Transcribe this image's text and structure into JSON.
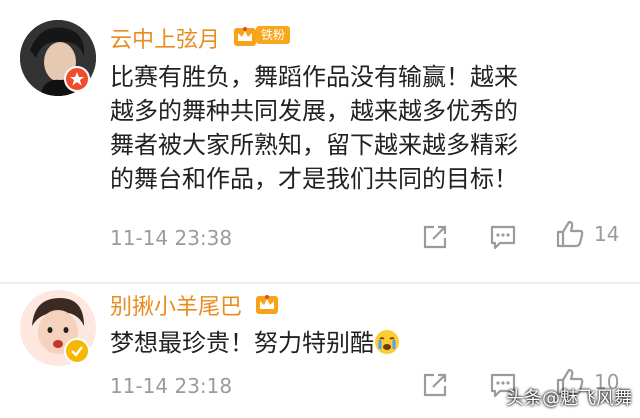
{
  "comments": [
    {
      "username": "云中上弦月",
      "fan_badge": "铁粉",
      "text": "比赛有胜负，舞蹈作品没有输赢！越来越多的舞种共同发展，越来越多优秀的舞者被大家所熟知，留下越来越多精彩的舞台和作品，才是我们共同的目标！",
      "timestamp": "11-14 23:38",
      "likes": "14"
    },
    {
      "username": "别揪小羊尾巴",
      "text": "梦想最珍贵！努力特别酷",
      "timestamp": "11-14 23:18",
      "likes": "10"
    }
  ],
  "watermark": "头条@魅飞风舞",
  "colors": {
    "username": "#e98c1f",
    "fan_badge": "#f8a61b",
    "meta": "#9b9b9b"
  }
}
